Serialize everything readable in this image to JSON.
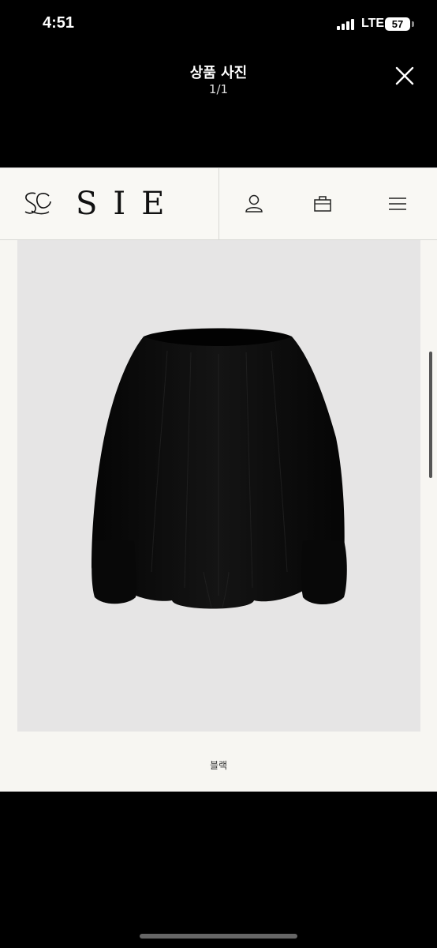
{
  "status_bar": {
    "time": "4:51",
    "network": "LTE",
    "battery": "57"
  },
  "viewer": {
    "title": "상품 사진",
    "counter": "1/1"
  },
  "site": {
    "logo_text": "SIE"
  },
  "product": {
    "caption": "블랙",
    "garment_color": "#0b0b0b",
    "background_color": "#e6e5e5"
  },
  "icons": [
    "close-icon",
    "user-icon",
    "bag-icon",
    "menu-icon"
  ]
}
